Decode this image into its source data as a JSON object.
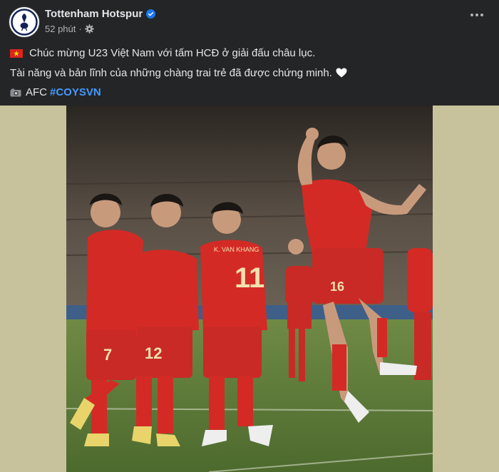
{
  "post": {
    "page_name": "Tottenham Hotspur",
    "time": "52 phút",
    "separator": "·",
    "caption_line1": "Chúc mừng U23 Việt Nam với tấm HCĐ ở giải đấu châu lục.",
    "caption_line2": "Tài năng và bản lĩnh của những chàng trai trẻ đã được chứng minh.",
    "caption_line3_prefix": "AFC",
    "hashtag": "#COYSVN"
  },
  "icons": {
    "avatar": "tottenham-logo",
    "verified": "verified-badge-icon",
    "audience": "gear-icon",
    "more": "more-options-icon",
    "flag": "vietnam-flag-icon",
    "heart": "white-heart-icon",
    "camera": "camera-icon"
  },
  "photo": {
    "description_visible_jersey_numbers": [
      "16",
      "11",
      "12",
      "7",
      "16"
    ],
    "jersey_name": "K. VAN KHANG"
  },
  "colors": {
    "background": "#242526",
    "text": "#e4e6eb",
    "secondary_text": "#b0b3b8",
    "hashtag": "#4599ff",
    "verified": "#1877f2",
    "photo_side": "#c7c29b",
    "kit_red": "#d42a25",
    "pitch": "#5b7a38"
  }
}
